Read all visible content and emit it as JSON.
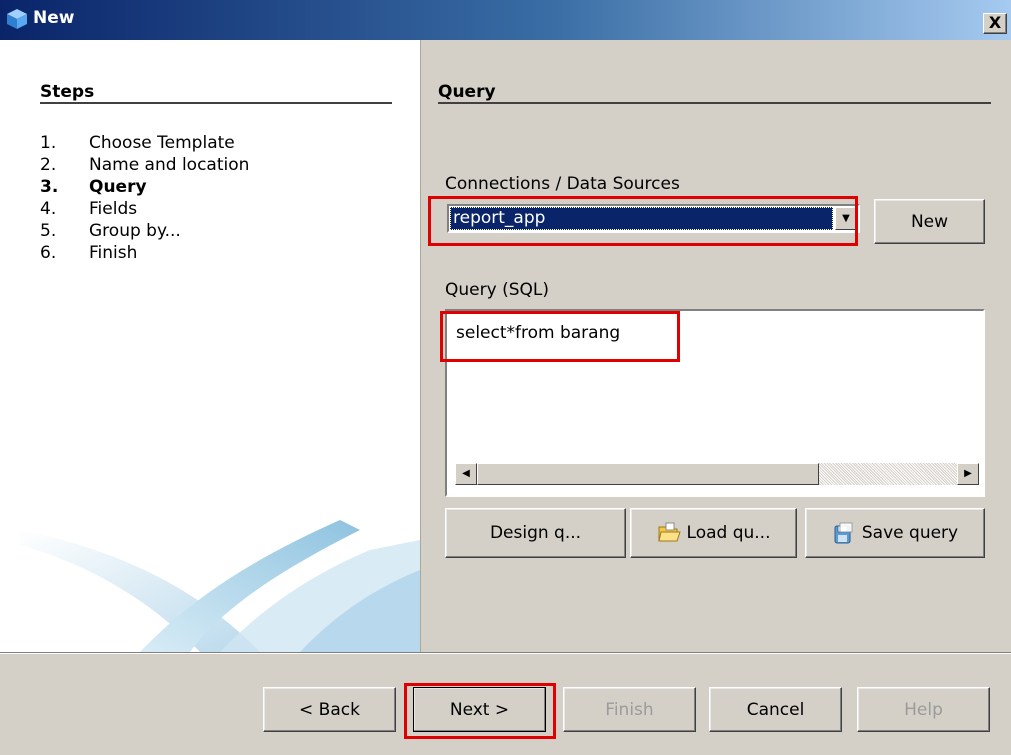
{
  "window": {
    "title": "New",
    "close_label": "X"
  },
  "steps": {
    "heading": "Steps",
    "items": [
      {
        "num": "1.",
        "label": "Choose Template"
      },
      {
        "num": "2.",
        "label": "Name and location"
      },
      {
        "num": "3.",
        "label": "Query"
      },
      {
        "num": "4.",
        "label": "Fields"
      },
      {
        "num": "5.",
        "label": "Group by..."
      },
      {
        "num": "6.",
        "label": "Finish"
      }
    ],
    "current_index": 2
  },
  "query": {
    "heading": "Query",
    "connections_label": "Connections / Data Sources",
    "connection_value": "report_app",
    "new_button": "New",
    "sql_label": "Query (SQL)",
    "sql_text": "select*from barang",
    "design_button": "Design q...",
    "load_button": "Load qu...",
    "save_button": "Save query"
  },
  "footer": {
    "back": "< Back",
    "next": "Next >",
    "finish": "Finish",
    "cancel": "Cancel",
    "help": "Help"
  },
  "colors": {
    "title_gradient_start": "#0a246a",
    "title_gradient_end": "#a6caf0",
    "selection": "#0a246a",
    "highlight": "#e00000",
    "dialog_bg": "#d4d0c8"
  }
}
